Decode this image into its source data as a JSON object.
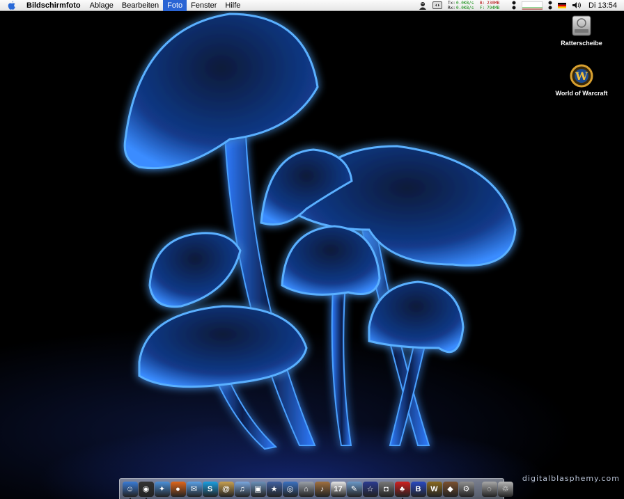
{
  "menubar": {
    "apple_icon": "apple-icon",
    "app_name": "Bildschirmfoto",
    "menus": [
      "Ablage",
      "Bearbeiten",
      "Foto",
      "Fenster",
      "Hilfe"
    ],
    "active_menu": "Foto",
    "network": {
      "tx_label": "Tx:",
      "tx_value": "0.0KB/s",
      "rx_label": "Rx:",
      "rx_value": "0.0KB/s",
      "b_label": "B:",
      "b_value": "230MB",
      "f_label": "F:",
      "f_value": "794MB"
    },
    "clock": "Di 13:54"
  },
  "desktop_icons": [
    {
      "label": "Ratterscheibe",
      "icon": "hard-drive-icon"
    },
    {
      "label": "World of Warcraft",
      "icon": "wow-icon"
    }
  ],
  "watermark": "digitalblasphemy.com",
  "dock": {
    "items": [
      {
        "name": "finder",
        "color": "#3a7bd5",
        "glyph": "☺",
        "running": true
      },
      {
        "name": "dashboard",
        "color": "#333333",
        "glyph": "◉",
        "running": true
      },
      {
        "name": "safari",
        "color": "#4a90d9",
        "glyph": "✦",
        "running": false
      },
      {
        "name": "firefox",
        "color": "#e0661b",
        "glyph": "●",
        "running": false
      },
      {
        "name": "ichat",
        "color": "#5aa0e6",
        "glyph": "✉",
        "running": false
      },
      {
        "name": "skype",
        "color": "#1a9ee0",
        "glyph": "S",
        "running": false
      },
      {
        "name": "address-book",
        "color": "#c8a050",
        "glyph": "@",
        "running": false
      },
      {
        "name": "itunes",
        "color": "#7aa8e0",
        "glyph": "♫",
        "running": false
      },
      {
        "name": "iphoto",
        "color": "#6a8fb8",
        "glyph": "▣",
        "running": false
      },
      {
        "name": "imovie",
        "color": "#4060a0",
        "glyph": "★",
        "running": false
      },
      {
        "name": "idvd",
        "color": "#3a70c0",
        "glyph": "◎",
        "running": false
      },
      {
        "name": "iweb",
        "color": "#9aa0a8",
        "glyph": "⌂",
        "running": false
      },
      {
        "name": "garageband",
        "color": "#a07040",
        "glyph": "♪",
        "running": false
      },
      {
        "name": "ical",
        "color": "#e8e8e8",
        "glyph": "17",
        "running": false
      },
      {
        "name": "preview",
        "color": "#6a98c8",
        "glyph": "✎",
        "running": false
      },
      {
        "name": "imovie-star",
        "color": "#2a3a90",
        "glyph": "☆",
        "running": false
      },
      {
        "name": "camera",
        "color": "#777777",
        "glyph": "◘",
        "running": false
      },
      {
        "name": "adium",
        "color": "#d02020",
        "glyph": "♣",
        "running": true
      },
      {
        "name": "b-app",
        "color": "#2848c0",
        "glyph": "B",
        "running": false
      },
      {
        "name": "world-of-warcraft",
        "color": "#8a6a20",
        "glyph": "W",
        "running": false
      },
      {
        "name": "mouse-app",
        "color": "#7a5030",
        "glyph": "◆",
        "running": false
      },
      {
        "name": "system-preferences",
        "color": "#909090",
        "glyph": "⚙",
        "running": false
      }
    ],
    "trail": [
      {
        "name": "downloads",
        "color": "#a8a8a8",
        "glyph": "◌"
      },
      {
        "name": "trash",
        "color": "#b8b8b8",
        "glyph": "♲"
      }
    ]
  }
}
